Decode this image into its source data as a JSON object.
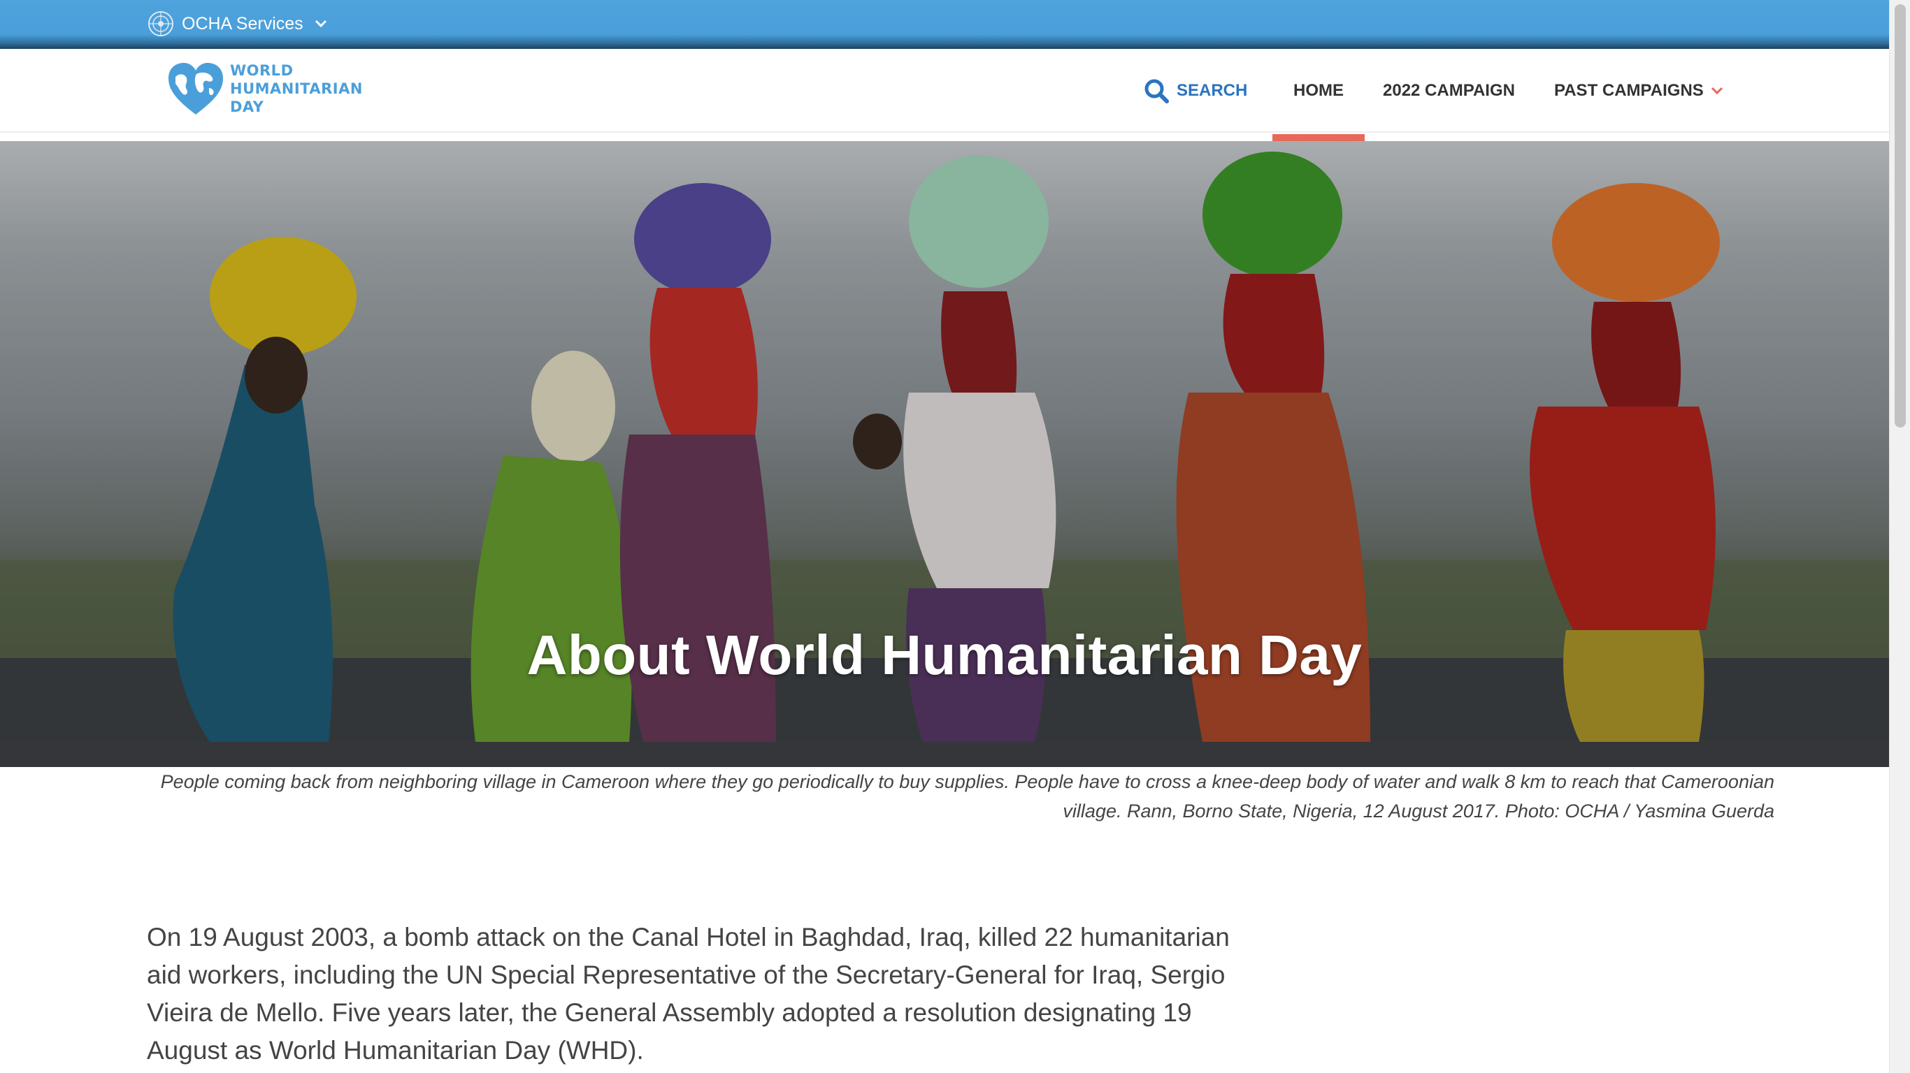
{
  "ocha_bar": {
    "services_label": "OCHA Services"
  },
  "logo": {
    "lines": [
      "WORLD",
      "HUMANITARIAN",
      "DAY"
    ]
  },
  "nav": {
    "search_label": "SEARCH",
    "home_label": "HOME",
    "campaign_2022_label": "2022 CAMPAIGN",
    "past_campaigns_label": "PAST CAMPAIGNS"
  },
  "hero": {
    "title": "About World Humanitarian Day",
    "caption": "People coming back from neighboring village in Cameroon where they go periodically to buy supplies. People have to cross a knee-deep body of water and walk 8 km to reach that Cameroonian village. Rann, Borno State, Nigeria, 12 August 2017. Photo: OCHA / Yasmina Guerda"
  },
  "content": {
    "paragraph": "On 19 August 2003, a bomb attack on the Canal Hotel in Baghdad, Iraq, killed 22 humanitarian aid workers, including the UN Special Representative of the Secretary-General for Iraq, Sergio Vieira de Mello. Five years later, the General Assembly adopted a resolution designating 19 August as World Humanitarian Day (WHD)."
  },
  "colors": {
    "ocha_blue": "#4a9fda",
    "brand_blue": "#2a74c0",
    "active_accent": "#e8685a",
    "text": "#444444"
  },
  "icons": {
    "un": "un-emblem-icon",
    "services_dropdown": "chevron-down-icon",
    "logo": "heart-globe-icon",
    "search": "search-icon",
    "past_dropdown": "chevron-down-icon"
  }
}
